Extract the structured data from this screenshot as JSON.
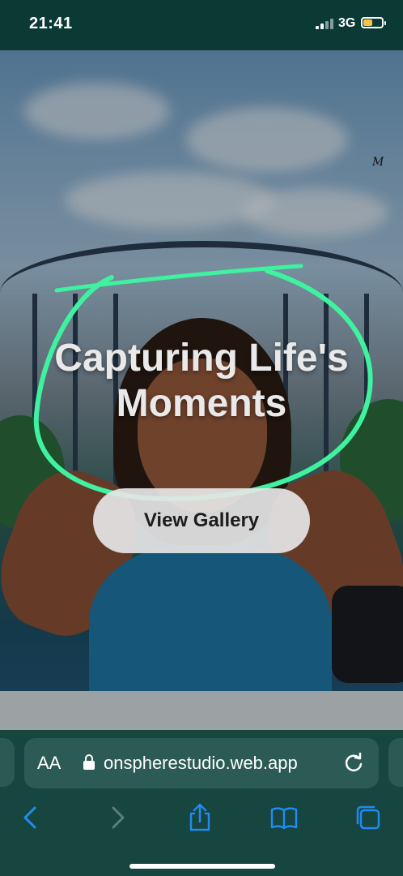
{
  "status_bar": {
    "time": "21:41",
    "network": "3G",
    "battery_level": 0.5,
    "icons": [
      "signal-icon",
      "battery-icon"
    ]
  },
  "hero": {
    "title_line1": "Capturing Life's",
    "title_line2": "Moments",
    "cta_label": "View Gallery",
    "annotation_color": "#3ef2a0"
  },
  "browser": {
    "text_size_label": "AA",
    "url": "onspherestudio.web.app",
    "icons": [
      "lock-icon",
      "reload-icon",
      "back-icon",
      "forward-icon",
      "share-icon",
      "bookmarks-icon",
      "tabs-icon"
    ]
  },
  "colors": {
    "accent": "#1e8cf0",
    "chrome_bg": "#17453f",
    "status_bg": "#0a3a33"
  }
}
